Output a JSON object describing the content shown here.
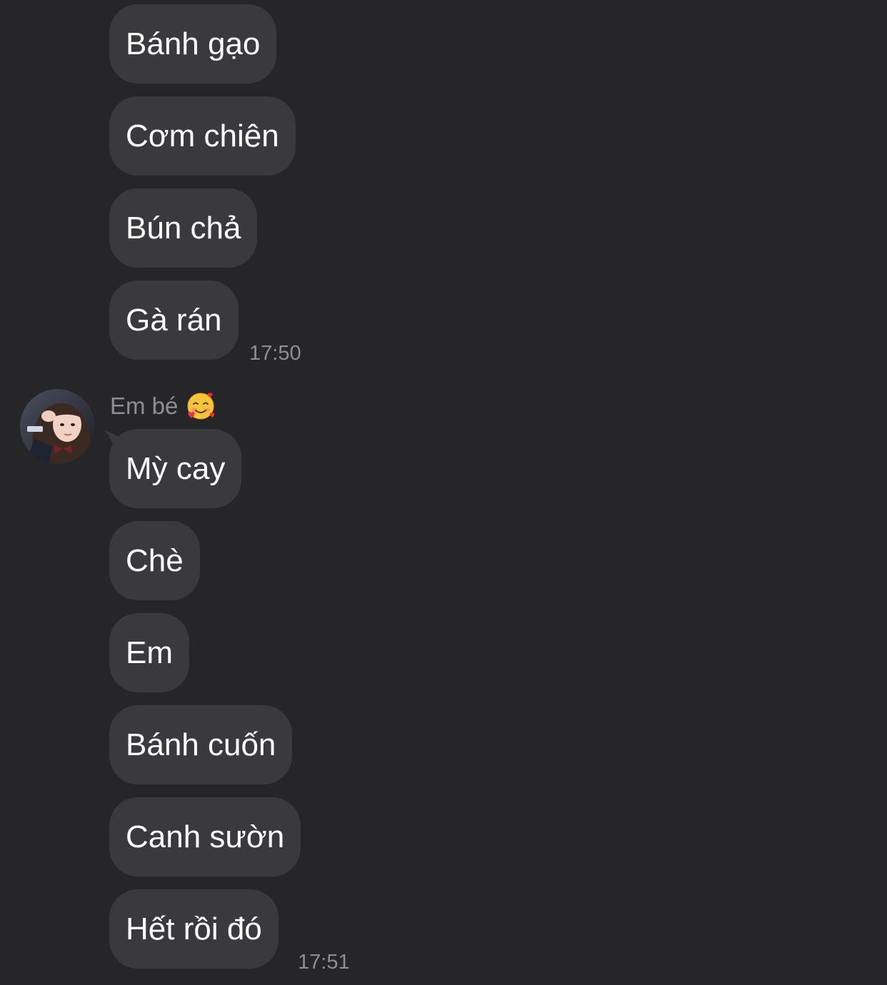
{
  "conversation": {
    "group1": {
      "messages": [
        "Bánh gạo",
        "Cơm chiên",
        "Bún chả",
        "Gà rán"
      ],
      "time": "17:50"
    },
    "group2": {
      "sender": {
        "name": "Em bé",
        "emoji": "smiling-face-with-hearts"
      },
      "messages": [
        "Mỳ cay",
        "Chè",
        "Em",
        "Bánh cuốn",
        "Canh sườn",
        "Hết rồi đó"
      ],
      "time": "17:51"
    }
  },
  "colors": {
    "background": "#262628",
    "bubble": "#3a3a3c",
    "text": "#ffffff",
    "meta_text": "#8e8e93"
  }
}
